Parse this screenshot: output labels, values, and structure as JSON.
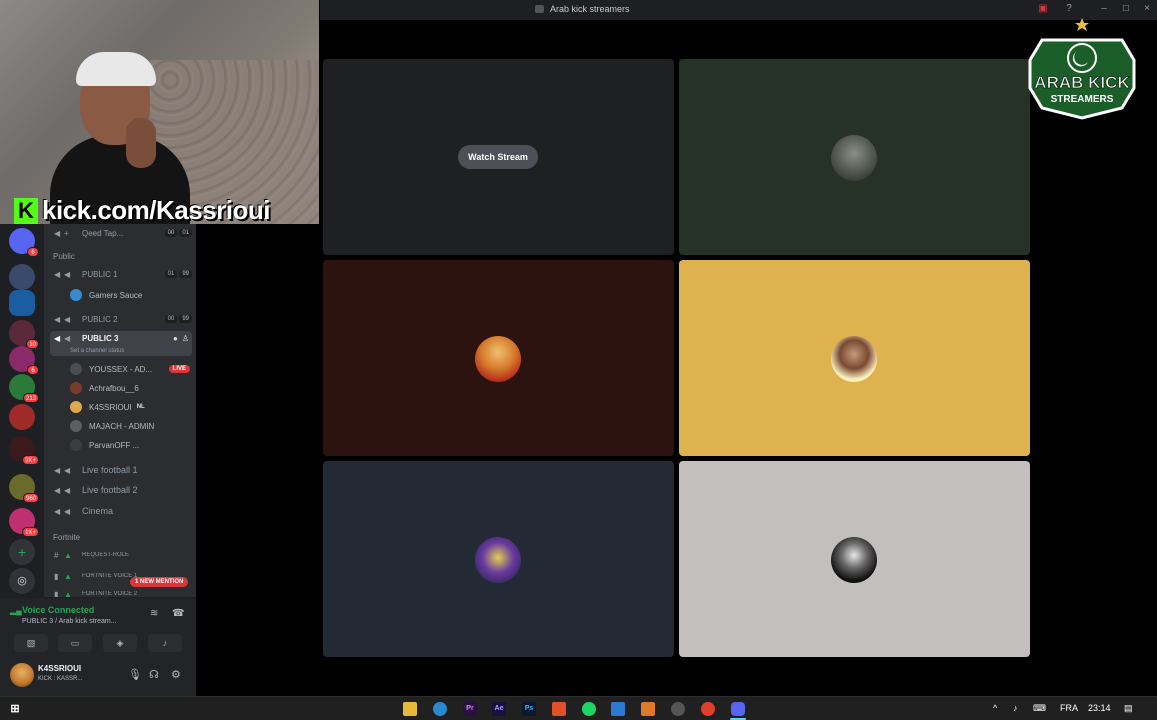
{
  "window": {
    "title": "Arab kick streamers"
  },
  "webcam": {
    "overlay_text": "kick.com/Kassrioui",
    "kick_letter": "K"
  },
  "logo": {
    "line1": "ARAB KICK",
    "line2": "STREAMERS"
  },
  "servers": [
    {
      "badge": "6"
    },
    {
      "badge": ""
    },
    {
      "badge": ""
    },
    {
      "badge": "10"
    },
    {
      "badge": "6"
    },
    {
      "badge": "213"
    },
    {
      "badge": ""
    },
    {
      "badge": "3K+"
    },
    {
      "badge": "960"
    },
    {
      "badge": "1K+"
    }
  ],
  "channels": {
    "top_channel": {
      "label": "Qeed Tap...",
      "count1": "00",
      "count2": "01"
    },
    "category_public": "Public",
    "public1": {
      "label": "PUBLIC 1",
      "count1": "01",
      "count2": "99"
    },
    "public1_user": "Gamers Sauce",
    "public2": {
      "label": "PUBLIC 2",
      "count1": "00",
      "count2": "99"
    },
    "public3": {
      "label": "PUBLIC 3",
      "status": "Set a channel status"
    },
    "public3_users": [
      {
        "name": "YOUSSEX - AD...",
        "live": "LIVE",
        "color": "#4a4d52"
      },
      {
        "name": "Achrafbou__6",
        "live": "",
        "color": "#7a3a2a"
      },
      {
        "name": "K4SSRIOUI",
        "live": "",
        "color": "#e0a848",
        "tag": "NL"
      },
      {
        "name": "MAJACH - ADMIN",
        "live": "",
        "color": "#5a5d62"
      },
      {
        "name": "ParvanOFF ...",
        "live": "",
        "color": "#3a3d42"
      }
    ],
    "live1": "Live football 1",
    "live2": "Live football 2",
    "cinema": "Cinema",
    "category_fortnite": "Fortnite",
    "request_role": "REQUEST-ROLE",
    "fortnite_voice1": "FORTNITE VOICE 1",
    "fortnite_voice2": "FORTNITE VOICE 2",
    "mention": "1 NEW MENTION"
  },
  "voice": {
    "title": "Voice Connected",
    "subtitle": "PUBLIC 3 / Arab kick stream..."
  },
  "user": {
    "name": "K4SSRIOUI",
    "status": "KICK : KASSR..."
  },
  "tiles": {
    "watch_label": "Watch Stream",
    "colors": [
      "#1f2022",
      "#263226",
      "#2c1310",
      "#deb24f",
      "#232a35",
      "#c2bfbe"
    ]
  },
  "taskbar": {
    "lang": "FRA",
    "time": "23:14"
  }
}
